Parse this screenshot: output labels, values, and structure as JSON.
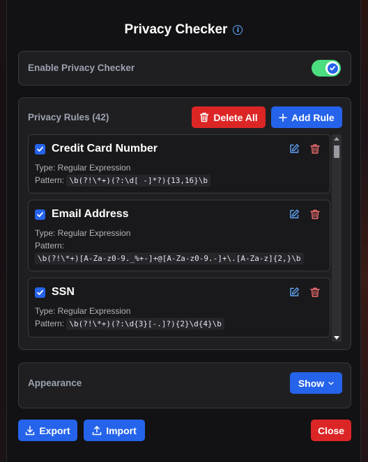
{
  "header": {
    "title": "Privacy Checker",
    "info_icon": "info-icon"
  },
  "enable_section": {
    "label": "Enable Privacy Checker",
    "toggle_on": true
  },
  "rules_section": {
    "title": "Privacy Rules (42)",
    "delete_all_label": "Delete All",
    "add_rule_label": "Add Rule",
    "rules": [
      {
        "name": "Credit Card Number",
        "type": "Type: Regular Expression",
        "pattern_label": "Pattern:",
        "pattern": "\\b(?!\\*+)(?:\\d[ -]*?){13,16}\\b",
        "checked": true
      },
      {
        "name": "Email Address",
        "type": "Type: Regular Expression",
        "pattern_label": "Pattern:",
        "pattern": "\\b(?!\\*+)[A-Za-z0-9._%+-]+@[A-Za-z0-9.-]+\\.[A-Za-z]{2,}\\b",
        "checked": true
      },
      {
        "name": "SSN",
        "type": "Type: Regular Expression",
        "pattern_label": "Pattern:",
        "pattern": "\\b(?!\\*+)(?:\\d{3}[-.]?){2}\\d{4}\\b",
        "checked": true
      }
    ]
  },
  "appearance_section": {
    "label": "Appearance",
    "show_label": "Show"
  },
  "footer": {
    "export_label": "Export",
    "import_label": "Import",
    "close_label": "Close"
  },
  "colors": {
    "accent_blue": "#2563eb",
    "danger_red": "#dc2626",
    "toggle_green": "#4ade80",
    "edit_icon": "#60a5fa",
    "delete_icon": "#f87171"
  }
}
